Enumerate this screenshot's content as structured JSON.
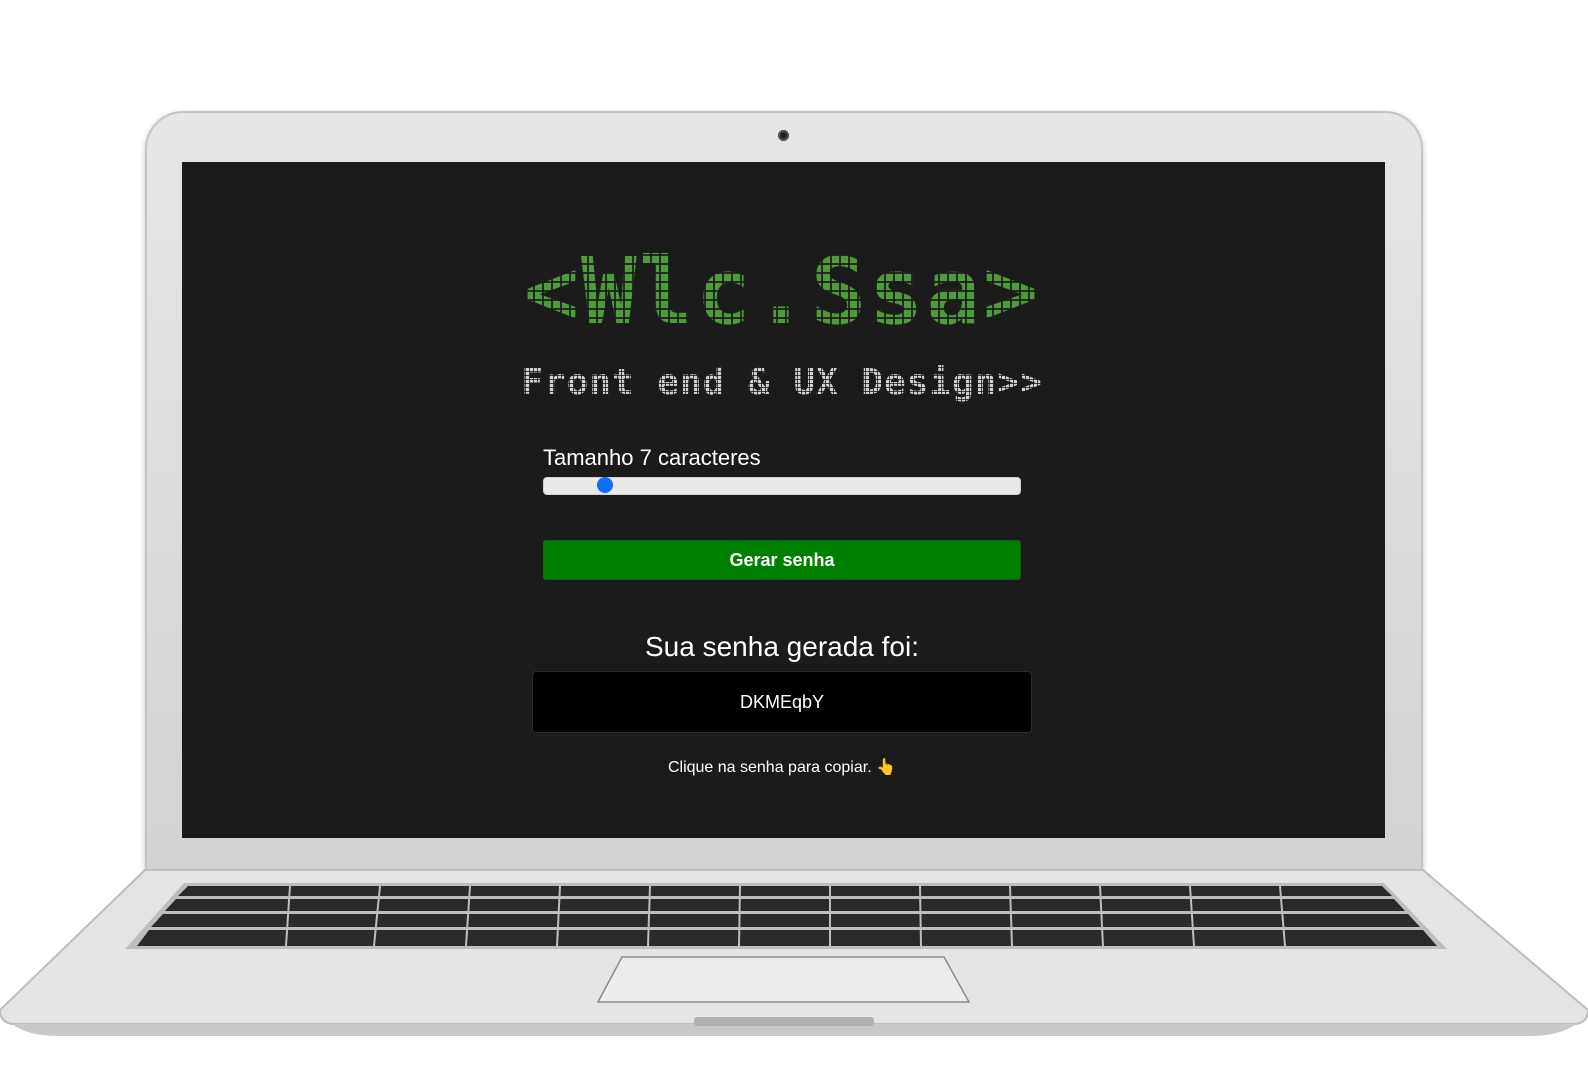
{
  "app": {
    "logo_text": "<Wlc.Ssa>",
    "subtitle": "Front end & UX Design>>"
  },
  "generator": {
    "length_label": "Tamanho 7 caracteres",
    "length_value": 7,
    "length_min": 6,
    "length_max": 30,
    "button_label": "Gerar senha"
  },
  "result": {
    "title": "Sua senha gerada foi:",
    "password": "DKMEqbY",
    "tip_text": "Clique na senha para copiar.",
    "tip_icon": "👆"
  },
  "colors": {
    "screen_bg": "#1b1b1b",
    "logo_green": "#4f9a3a",
    "button_green": "#008000",
    "slider_thumb": "#0d6efd"
  }
}
